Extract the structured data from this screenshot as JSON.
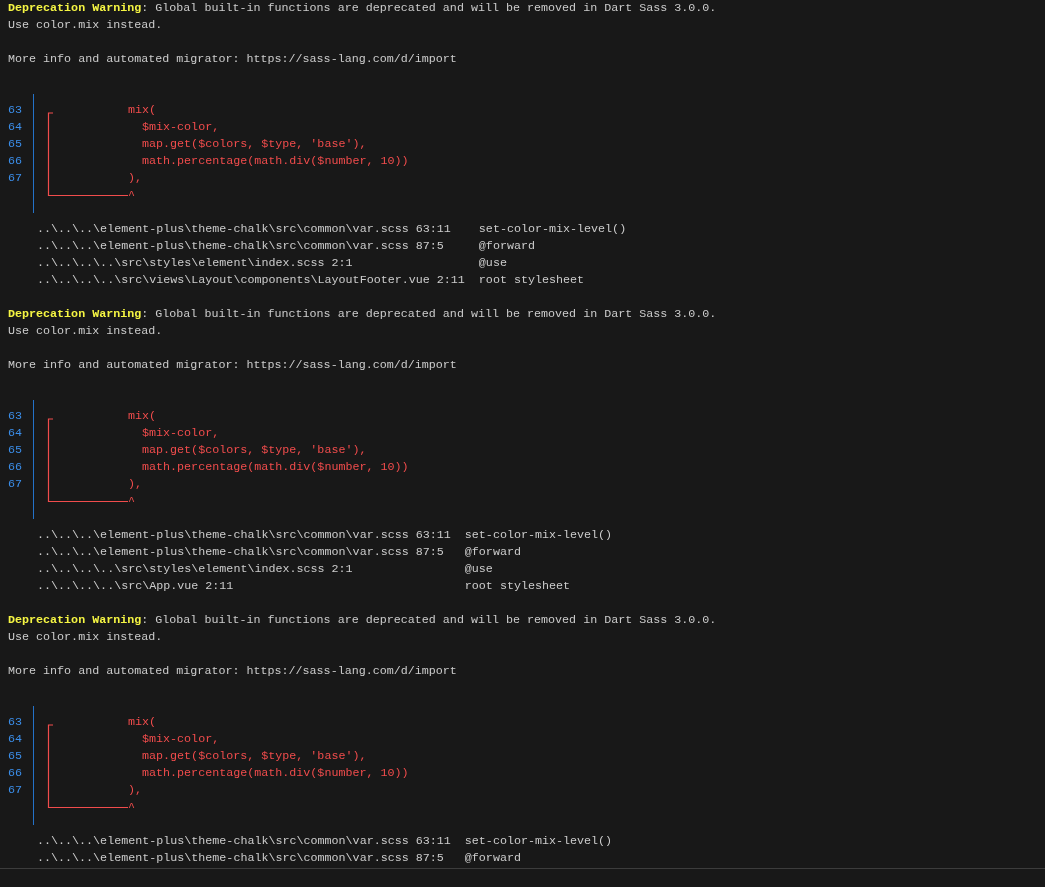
{
  "blocks": [
    {
      "warning": "**Deprecation Warning**: Global built-in functions are deprecated and will be removed in Dart Sass 3.0.0.",
      "hint": "Use color.mix instead.",
      "more_info": "More info and automated migrator: https://sass-lang.com/d/import",
      "snippet": {
        "lines": [
          {
            "number": "63",
            "code": "mix("
          },
          {
            "number": "64",
            "code": "  $mix-color,"
          },
          {
            "number": "65",
            "code": "  map.get($colors, $type, 'base'),"
          },
          {
            "number": "66",
            "code": "  math.percentage(math.div($number, 10))"
          },
          {
            "number": "67",
            "code": "),"
          }
        ],
        "caret": "^"
      },
      "trace": [
        {
          "location": "..\\..\\..\\element-plus\\theme-chalk\\src\\common\\var.scss 63:11",
          "member": "set-color-mix-level()"
        },
        {
          "location": "..\\..\\..\\element-plus\\theme-chalk\\src\\common\\var.scss 87:5",
          "member": "@forward"
        },
        {
          "location": "..\\..\\..\\..\\src\\styles\\element\\index.scss 2:1",
          "member": "@use"
        },
        {
          "location": "..\\..\\..\\..\\src\\views\\Layout\\components\\LayoutFooter.vue 2:11",
          "member": "root stylesheet"
        }
      ]
    },
    {
      "warning": "**Deprecation Warning**: Global built-in functions are deprecated and will be removed in Dart Sass 3.0.0.",
      "hint": "Use color.mix instead.",
      "more_info": "More info and automated migrator: https://sass-lang.com/d/import",
      "snippet": {
        "lines": [
          {
            "number": "63",
            "code": "mix("
          },
          {
            "number": "64",
            "code": "  $mix-color,"
          },
          {
            "number": "65",
            "code": "  map.get($colors, $type, 'base'),"
          },
          {
            "number": "66",
            "code": "  math.percentage(math.div($number, 10))"
          },
          {
            "number": "67",
            "code": "),"
          }
        ],
        "caret": "^"
      },
      "trace": [
        {
          "location": "..\\..\\..\\element-plus\\theme-chalk\\src\\common\\var.scss 63:11",
          "member": "set-color-mix-level()"
        },
        {
          "location": "..\\..\\..\\element-plus\\theme-chalk\\src\\common\\var.scss 87:5",
          "member": "@forward"
        },
        {
          "location": "..\\..\\..\\..\\src\\styles\\element\\index.scss 2:1",
          "member": "@use"
        },
        {
          "location": "..\\..\\..\\..\\src\\App.vue 2:11",
          "member": "root stylesheet"
        }
      ]
    },
    {
      "warning": "**Deprecation Warning**: Global built-in functions are deprecated and will be removed in Dart Sass 3.0.0.",
      "hint": "Use color.mix instead.",
      "more_info": "More info and automated migrator: https://sass-lang.com/d/import",
      "snippet": {
        "lines": [
          {
            "number": "63",
            "code": "mix("
          },
          {
            "number": "64",
            "code": "  $mix-color,"
          },
          {
            "number": "65",
            "code": "  map.get($colors, $type, 'base'),"
          },
          {
            "number": "66",
            "code": "  math.percentage(math.div($number, 10))"
          },
          {
            "number": "67",
            "code": "),"
          }
        ],
        "caret": "^"
      },
      "trace": [
        {
          "location": "..\\..\\..\\element-plus\\theme-chalk\\src\\common\\var.scss 63:11",
          "member": "set-color-mix-level()"
        },
        {
          "location": "..\\..\\..\\element-plus\\theme-chalk\\src\\common\\var.scss 87:5",
          "member": "@forward"
        }
      ]
    }
  ]
}
